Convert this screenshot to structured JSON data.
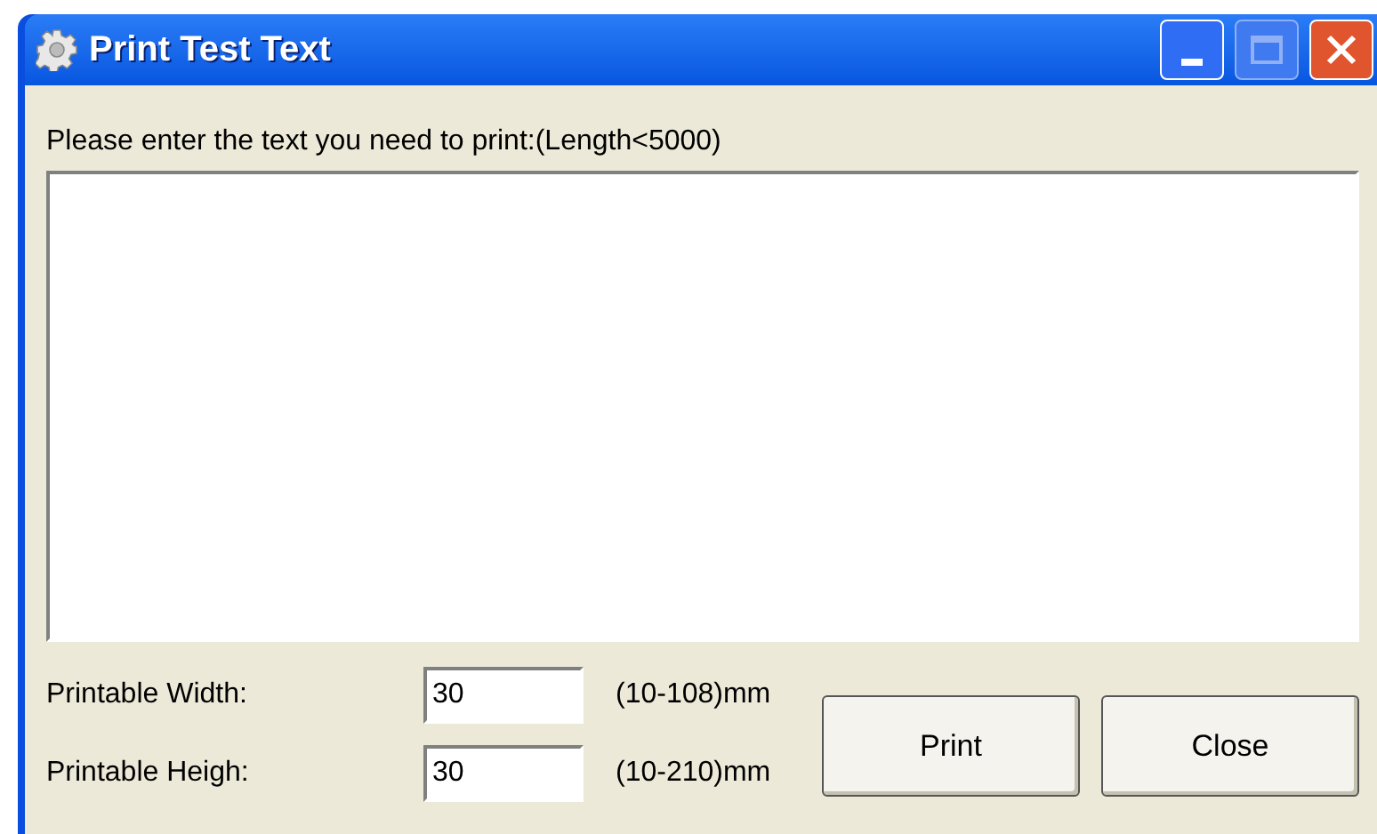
{
  "window": {
    "title": "Print Test Text"
  },
  "prompt": "Please enter the text you need to print:(Length<5000)",
  "fields": [
    {
      "label": "Printable Width:",
      "value": "30",
      "range": "(10-108)mm"
    },
    {
      "label": "Printable Heigh:",
      "value": "30",
      "range": "(10-210)mm"
    }
  ],
  "buttons": [
    "Print",
    "Close"
  ]
}
